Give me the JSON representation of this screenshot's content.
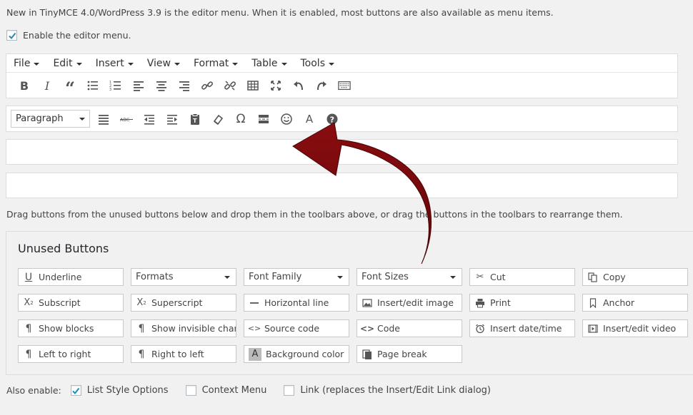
{
  "intro_text": "New in TinyMCE 4.0/WordPress 3.9 is the editor menu. When it is enabled, most buttons are also available as menu items.",
  "enable_menu": {
    "label": "Enable the editor menu.",
    "checked": true
  },
  "menubar": {
    "items": [
      "File",
      "Edit",
      "Insert",
      "View",
      "Format",
      "Table",
      "Tools"
    ]
  },
  "toolbar1": {
    "icons": [
      "bold-icon",
      "italic-icon",
      "blockquote-icon",
      "bullet-list-icon",
      "numbered-list-icon",
      "align-left-icon",
      "align-center-icon",
      "align-right-icon",
      "link-icon",
      "unlink-icon",
      "table-icon",
      "fullscreen-icon",
      "undo-icon",
      "redo-icon",
      "toolbar-toggle-icon"
    ]
  },
  "toolbar2": {
    "format_select": "Paragraph",
    "icons": [
      "justify-icon",
      "strikethrough-icon",
      "outdent-icon",
      "indent-icon",
      "paste-text-icon",
      "clear-formatting-icon",
      "special-character-icon",
      "more-tag-icon",
      "emoticons-icon",
      "text-color-icon",
      "help-icon"
    ]
  },
  "drag_text": "Drag buttons from the unused buttons below and drop them in the toolbars above, or drag the buttons in the toolbars to rearrange them.",
  "unused": {
    "title": "Unused Buttons",
    "buttons": [
      {
        "label": "Underline",
        "icon": "underline-icon"
      },
      {
        "label": "Formats",
        "select": true
      },
      {
        "label": "Font Family",
        "select": true
      },
      {
        "label": "Font Sizes",
        "select": true
      },
      {
        "label": "Cut",
        "icon": "cut-icon"
      },
      {
        "label": "Copy",
        "icon": "copy-icon"
      },
      {
        "label": "Subscript",
        "icon": "subscript-icon"
      },
      {
        "label": "Superscript",
        "icon": "superscript-icon"
      },
      {
        "label": "Horizontal line",
        "icon": "horizontal-line-icon"
      },
      {
        "label": "Insert/edit image",
        "icon": "image-icon"
      },
      {
        "label": "Print",
        "icon": "print-icon"
      },
      {
        "label": "Anchor",
        "icon": "anchor-icon"
      },
      {
        "label": "Show blocks",
        "icon": "show-blocks-icon"
      },
      {
        "label": "Show invisible char...",
        "icon": "show-invisible-icon"
      },
      {
        "label": "Source code",
        "icon": "source-code-icon"
      },
      {
        "label": "Code",
        "icon": "code-icon"
      },
      {
        "label": "Insert date/time",
        "icon": "clock-icon"
      },
      {
        "label": "Insert/edit video",
        "icon": "video-icon"
      },
      {
        "label": "Left to right",
        "icon": "ltr-icon"
      },
      {
        "label": "Right to left",
        "icon": "rtl-icon"
      },
      {
        "label": "Background color",
        "icon": "background-color-icon"
      },
      {
        "label": "Page break",
        "icon": "page-break-icon"
      }
    ]
  },
  "also_enable": {
    "label": "Also enable:",
    "options": [
      {
        "label": "List Style Options",
        "checked": true
      },
      {
        "label": "Context Menu",
        "checked": false
      },
      {
        "label": "Link (replaces the Insert/Edit Link dialog)",
        "checked": false
      }
    ]
  },
  "colors": {
    "arrow": "#7a0a0c",
    "border": "#dddddd",
    "background": "#f1f1f1"
  }
}
